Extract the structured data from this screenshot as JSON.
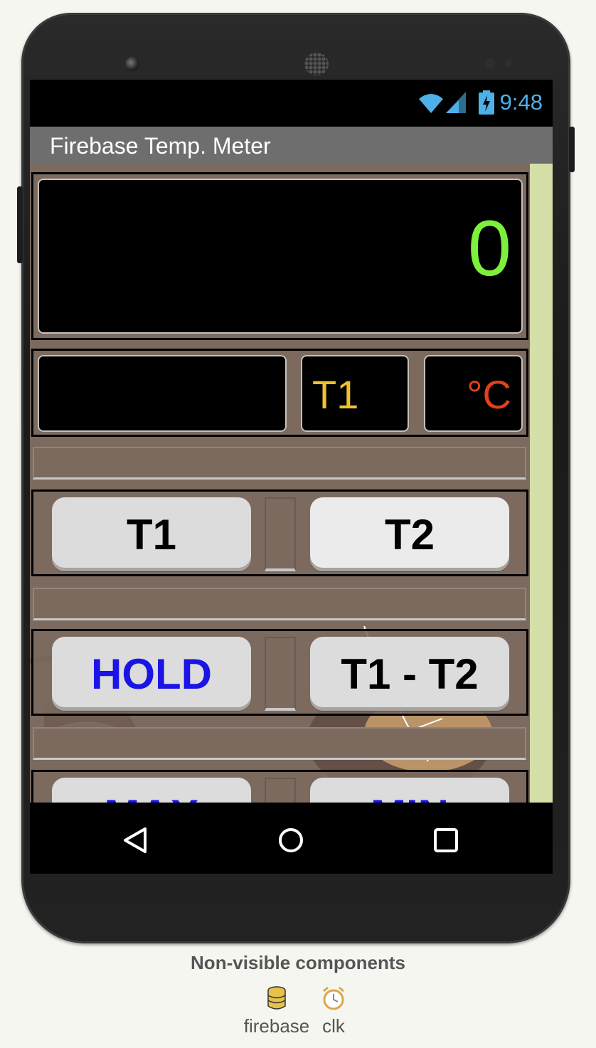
{
  "status_bar": {
    "time": "9:48",
    "icons": [
      "wifi-icon",
      "signal-icon",
      "battery-charging-icon"
    ]
  },
  "app": {
    "title": "Firebase Temp. Meter"
  },
  "display": {
    "main_value": "0",
    "main_value_color": "#7cf13c",
    "channel_label": "T1",
    "channel_color": "#f0c030",
    "unit_label": "°C",
    "unit_color": "#e3401c",
    "sub_value": ""
  },
  "buttons": {
    "t1": "T1",
    "t2": "T2",
    "hold": "HOLD",
    "hold_color": "#1a14e6",
    "diff": "T1 - T2",
    "max": "MAX",
    "min": "MIN",
    "maxmin_color": "#1a14e6"
  },
  "nav": {
    "icons": [
      "back-icon",
      "home-icon",
      "recents-icon"
    ]
  },
  "non_visible": {
    "title": "Non-visible components",
    "items": [
      {
        "label": "firebase",
        "icon": "database-icon"
      },
      {
        "label": "clk",
        "icon": "clock-icon"
      }
    ]
  }
}
